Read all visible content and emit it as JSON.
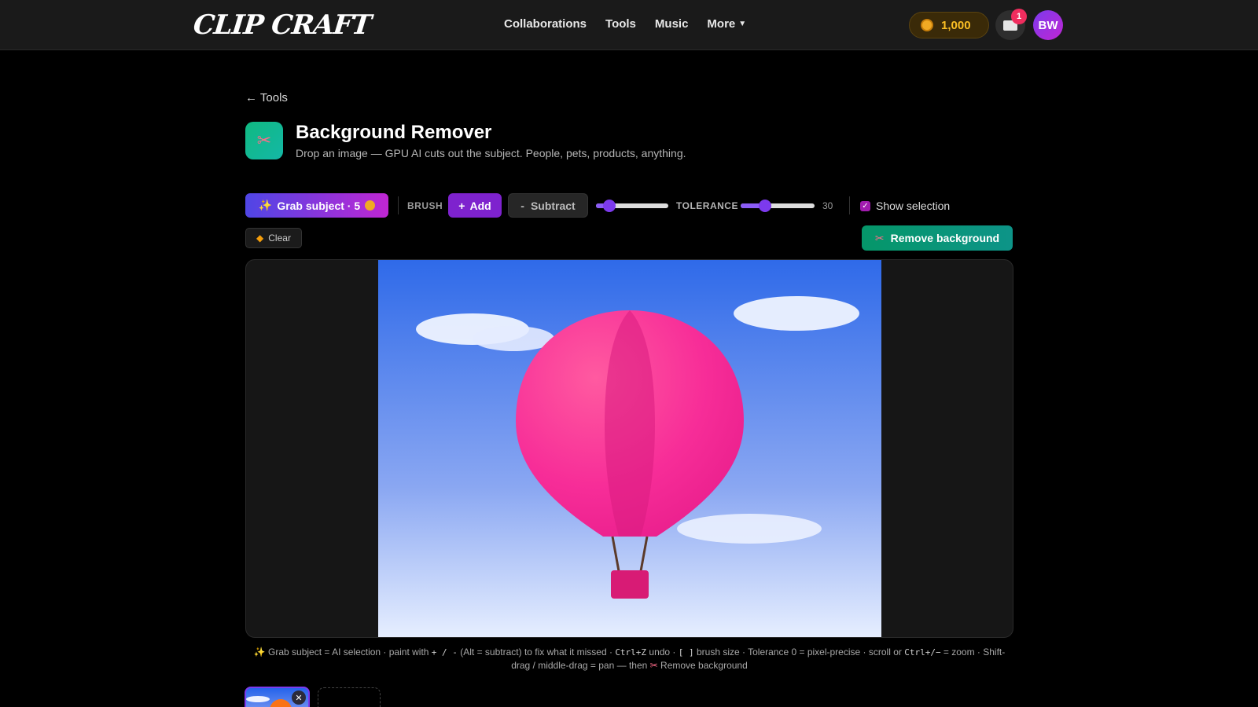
{
  "header": {
    "logo_text": "CLIP CRAFT",
    "nav": [
      {
        "label": "Collaborations"
      },
      {
        "label": "Tools"
      },
      {
        "label": "Music"
      },
      {
        "label": "More"
      }
    ],
    "coins": "1,000",
    "notifications_count": "1",
    "avatar_initials": "BW"
  },
  "page": {
    "back_link": "← Tools",
    "title": "Background Remover",
    "subtitle": "Drop an image — GPU AI cuts out the subject. People, pets, products, anything."
  },
  "toolbar": {
    "grab_label": "Grab subject · 5",
    "brush_label": "BRUSH",
    "add_label": "Add",
    "subtract_label": "Subtract",
    "brush_size_level": 0.18,
    "tolerance_label": "TOLERANCE",
    "tolerance_value": "30",
    "tolerance_level": 0.33,
    "show_selection_label": "Show selection",
    "show_selection_checked": true,
    "clear_label": "Clear",
    "remove_label": "Remove background"
  },
  "help": {
    "part1": "Grab subject = AI selection · paint with ",
    "part2": " (Alt = subtract) to fix what it missed · ",
    "key1": "+ / -",
    "key2": "Ctrl+Z",
    "part3": " undo · ",
    "key3": "[ ]",
    "part4": " brush size · Tolerance 0 = pixel-precise · scroll or ",
    "key4": "Ctrl+/−",
    "part5": " = zoom · Shift-drag / middle-drag = pan — then ",
    "part6": " Remove background"
  },
  "colors": {
    "accent": "#7c3aed",
    "remove_button": "#059669",
    "coin": "#fbbf24",
    "badge": "#ef2d5e"
  },
  "icons": {
    "grab": "sparkles-icon",
    "add": "plus-icon",
    "subtract": "minus-icon",
    "clear": "eraser-icon",
    "remove": "scissors-icon",
    "thumb_close": "close-icon"
  }
}
